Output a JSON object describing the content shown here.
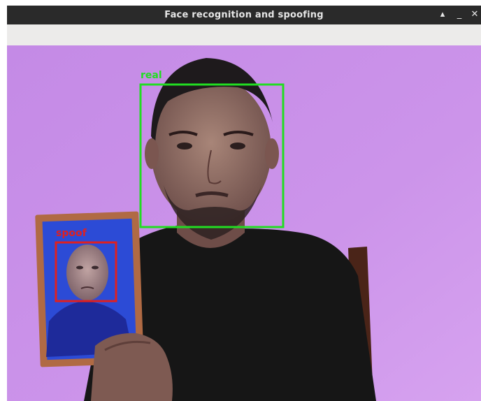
{
  "window": {
    "title": "Face recognition and spoofing",
    "controls": {
      "maximize": "▴",
      "minimize": "_",
      "close": "✕"
    }
  },
  "detections": [
    {
      "label": "real",
      "color": "#22dd22"
    },
    {
      "label": "spoof",
      "color": "#e02020"
    }
  ],
  "colors": {
    "titlebar": "#2a2a2a",
    "toolbar": "#ecebea",
    "wall": "#c98ee8",
    "real_box": "#22dd22",
    "spoof_box": "#e02020"
  }
}
